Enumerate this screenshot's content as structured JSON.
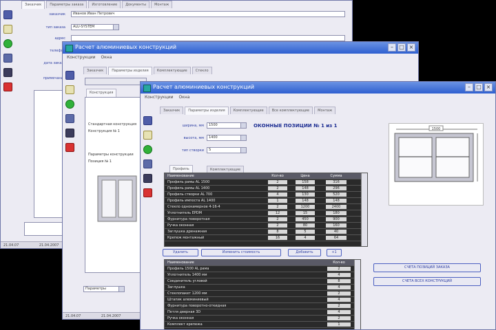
{
  "app": {
    "title": "Расчет алюминиевых конструкций"
  },
  "window1": {
    "tabs": [
      "Заказчик",
      "Параметры заказа",
      "Изготовление",
      "Документы",
      "Монтаж"
    ],
    "fields": [
      {
        "label": "заказчик",
        "value": "Иванов Иван Петрович"
      },
      {
        "label": "тип заказа",
        "value": "ALU-SYSTEM"
      },
      {
        "label": "адрес",
        "value": ""
      },
      {
        "label": "телефон",
        "value": ""
      },
      {
        "label": "дата заказа",
        "value": ""
      },
      {
        "label": "примечание",
        "value": ""
      }
    ],
    "status": {
      "left": "21.04.07",
      "right": "21.04.2007"
    }
  },
  "window2": {
    "menu": [
      "Конструкции",
      "Окна"
    ],
    "tabs": [
      "Заказчик",
      "Параметры изделия",
      "Комплектующие",
      "Стекло"
    ],
    "inner_tab": "Конструкция",
    "text_lines": [
      "Стандартная конструкция",
      "Конструкция № 1",
      "Параметры конструкции",
      "Позиция № 1"
    ],
    "select_value": "Параметры",
    "status": {
      "left": "21.04.07",
      "right": "21.04.2007"
    }
  },
  "window3": {
    "menu": [
      "Конструкции",
      "Окна"
    ],
    "tabs": [
      "Заказчик",
      "Параметры изделия",
      "Комплектующие",
      "Все комплектующие",
      "Монтаж"
    ],
    "fields": [
      {
        "label": "ширина, мм",
        "value": "1500"
      },
      {
        "label": "высота, мм",
        "value": "1400"
      },
      {
        "label": "тип створки",
        "value": "S"
      }
    ],
    "heading": "ОКОННЫЕ ПОЗИЦИИ № 1 из 1",
    "subtabs": [
      "Профиль",
      "Комплектующие"
    ],
    "drawing_width_label": "1500",
    "grid1": {
      "columns": [
        "Наименование",
        "Кол-во",
        "Цена",
        "Сумма"
      ],
      "rows": [
        [
          "Профиль рамы AL 1500",
          "2",
          "158",
          "316"
        ],
        [
          "Профиль рамы AL 1400",
          "2",
          "148",
          "296"
        ],
        [
          "Профиль створки AL 700",
          "4",
          "130",
          "520"
        ],
        [
          "Профиль импоста AL 1400",
          "1",
          "148",
          "148"
        ],
        [
          "Стекло однокамерное 4-16-4",
          "2",
          "1200",
          "2400"
        ],
        [
          "Уплотнитель EPDM",
          "12",
          "15",
          "180"
        ],
        [
          "Фурнитура поворотная",
          "2",
          "450",
          "900"
        ],
        [
          "Ручка оконная",
          "2",
          "80",
          "160"
        ],
        [
          "Заглушка дренажная",
          "8",
          "5",
          "40"
        ],
        [
          "Крепеж монтажный",
          "16",
          "4",
          "64"
        ]
      ]
    },
    "buttons": [
      "Удалить",
      "Изменить стоимость",
      "Добавить",
      "+1"
    ],
    "grid2": {
      "columns": [
        "Наименование",
        "Кол-во"
      ],
      "rows": [
        [
          "Профиль 1500 AL рама",
          "2"
        ],
        [
          "Уплотнитель 1400 мм",
          "4"
        ],
        [
          "Соединитель угловой",
          "8"
        ],
        [
          "Заглушка",
          "4"
        ],
        [
          "Стеклопакет 1200 мм",
          "2"
        ],
        [
          "Штапик алюминиевый",
          "4"
        ],
        [
          "Фурнитура поворотно-откидная",
          "2"
        ],
        [
          "Петля дверная 3D",
          "4"
        ],
        [
          "Ручка оконная",
          "2"
        ],
        [
          "Комплект крепежа",
          "1"
        ]
      ]
    },
    "side_buttons": [
      "СЧЕТА ПОЗИЦИЙ ЗАКАЗА",
      "СЧЕТА ВСЕХ КОНСТРУКЦИЙ"
    ],
    "colors": {
      "title_start": "#6b92e3",
      "title_end": "#2e5fd0",
      "label": "#2e3fa3",
      "grid_bg": "#2a2a2a"
    }
  }
}
